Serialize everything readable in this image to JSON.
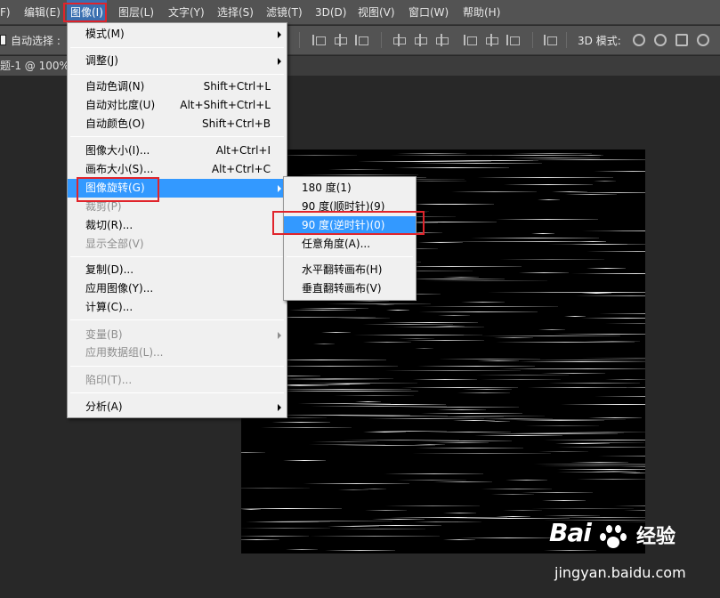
{
  "menubar": {
    "items": [
      "F)",
      "编辑(E)",
      "图像(I)",
      "图层(L)",
      "文字(Y)",
      "选择(S)",
      "滤镜(T)",
      "3D(D)",
      "视图(V)",
      "窗口(W)",
      "帮助(H)"
    ]
  },
  "options_bar": {
    "auto_select_label": "自动选择 :",
    "mode_3d_label": "3D 模式:"
  },
  "document_tab": {
    "title": "题-1 @ 100%"
  },
  "image_menu": {
    "mode": "模式(M)",
    "adjust": "调整(J)",
    "auto_tone": "自动色调(N)",
    "auto_tone_sc": "Shift+Ctrl+L",
    "auto_contrast": "自动对比度(U)",
    "auto_contrast_sc": "Alt+Shift+Ctrl+L",
    "auto_color": "自动颜色(O)",
    "auto_color_sc": "Shift+Ctrl+B",
    "image_size": "图像大小(I)...",
    "image_size_sc": "Alt+Ctrl+I",
    "canvas_size": "画布大小(S)...",
    "canvas_size_sc": "Alt+Ctrl+C",
    "image_rotation": "图像旋转(G)",
    "crop": "裁剪(P)",
    "trim": "裁切(R)...",
    "reveal_all": "显示全部(V)",
    "duplicate": "复制(D)...",
    "apply_image": "应用图像(Y)...",
    "calculations": "计算(C)...",
    "variables": "变量(B)",
    "apply_dataset": "应用数据组(L)...",
    "trap": "陷印(T)...",
    "analysis": "分析(A)"
  },
  "rotation_submenu": {
    "r180": "180 度(1)",
    "r90cw": "90 度(顺时针)(9)",
    "r90ccw": "90 度(逆时针)(0)",
    "arbitrary": "任意角度(A)...",
    "flip_h": "水平翻转画布(H)",
    "flip_v": "垂直翻转画布(V)"
  },
  "watermark": {
    "brand": "Bai",
    "brand2": "经验",
    "url": "jingyan.baidu.com"
  },
  "colors": {
    "highlight": "#3399ff",
    "annotation_red": "#e0242b",
    "panel": "#535353",
    "workspace": "#282828"
  }
}
